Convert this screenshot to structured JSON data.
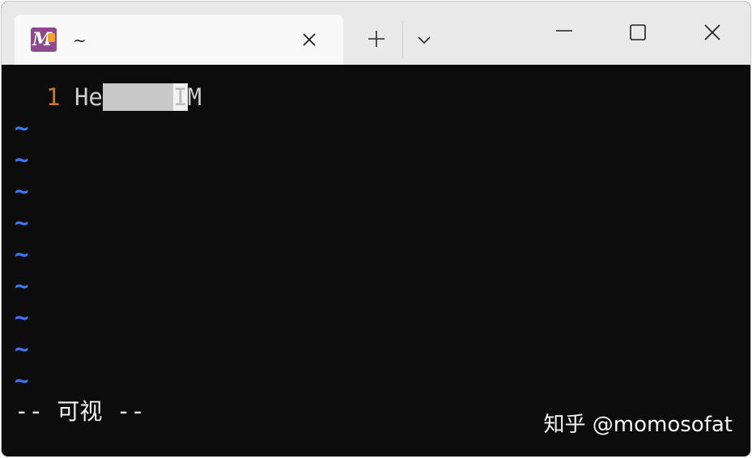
{
  "tab": {
    "title": "~",
    "icon": "m2-app-icon",
    "icon_letter": "M"
  },
  "titlebar": {
    "new_tab_icon": "plus-icon",
    "dropdown_icon": "chevron-down-icon",
    "minimize_icon": "minimize-icon",
    "maximize_icon": "maximize-icon",
    "close_icon": "close-icon"
  },
  "editor": {
    "line_number": "1",
    "text_before_selection": "He",
    "selected_text": "     ",
    "cursor_char": "I",
    "text_after_cursor": "M",
    "empty_line_marker": "~",
    "empty_line_count": 9,
    "mode_left_dashes": "--",
    "mode_label": "可视",
    "mode_right_dashes": "--"
  },
  "watermark": {
    "text": "知乎 @momosofat"
  },
  "colors": {
    "terminal_bg": "#0c0c0c",
    "line_number": "#c97a28",
    "tilde": "#3b78ff",
    "selection": "#c8c8c8",
    "titlebar_bg": "#e9e9e9",
    "tab_bg": "#f9f9f9"
  }
}
